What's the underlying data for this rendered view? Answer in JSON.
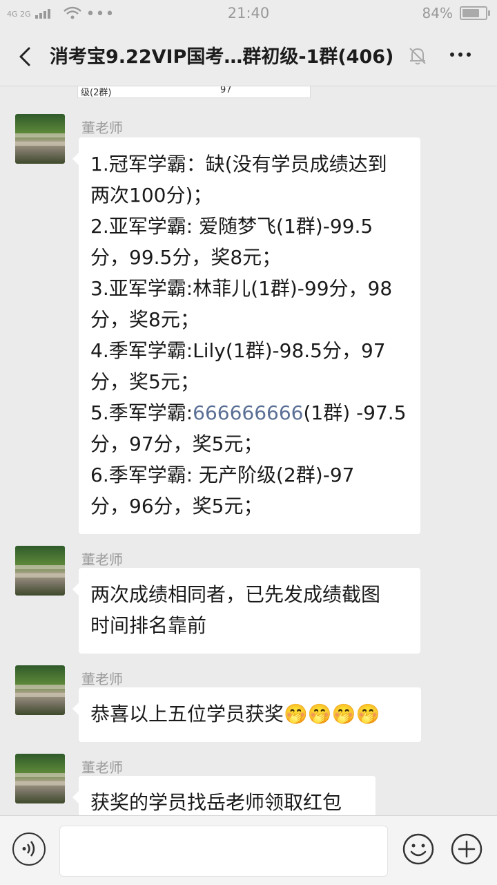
{
  "status": {
    "signal_left": "4G 2G",
    "dots": "•••",
    "time": "21:40",
    "battery": "84%",
    "battery_level": 0.84
  },
  "header": {
    "title": "消考宝9.22VIP国考…群初级-1群(406)"
  },
  "clipped_image": {
    "left_text": "级(2群)",
    "right_text": "97"
  },
  "messages": [
    {
      "sender": "董老师",
      "lines": [
        "1.冠军学霸：缺(没有学员成绩达到",
        "两次100分)；",
        "2.亚军学霸: 爱随梦飞(1群)-99.5",
        "分，99.5分，奖8元；",
        "3.亚军学霸:林菲儿(1群)-99分，98",
        "分，奖8元；",
        "4.季军学霸:Lily(1群)-98.5分，97",
        "分，奖5元；",
        "5.季军学霸:",
        "666666666",
        "(1群) -97.5",
        "分，97分，奖5元；",
        "6.季军学霸: 无产阶级(2群)-97",
        "分，96分，奖5元；"
      ]
    },
    {
      "sender": "董老师",
      "lines": [
        "两次成绩相同者，已先发成绩截图",
        "时间排名靠前"
      ]
    },
    {
      "sender": "董老师",
      "lines": [
        "恭喜以上五位学员获奖",
        "🤭🤭🤭🤭"
      ]
    },
    {
      "sender": "董老师",
      "lines": [
        "获奖的学员找岳老师领取红包"
      ]
    }
  ],
  "icons": {
    "back": "back-arrow-icon",
    "bell": "mute-bell-icon",
    "more": "more-dots-icon",
    "voice": "voice-icon",
    "emoji": "emoji-icon",
    "plus": "plus-icon"
  }
}
